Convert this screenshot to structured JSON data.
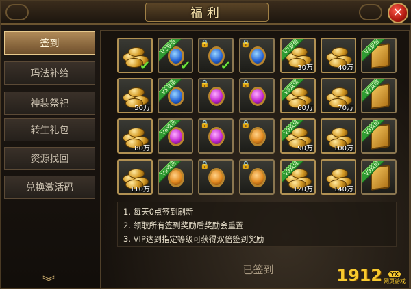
{
  "window": {
    "title": "福利",
    "close_icon": "close-x-icon"
  },
  "sidebar": {
    "items": [
      {
        "label": "签到",
        "active": true
      },
      {
        "label": "玛法补给",
        "active": false
      },
      {
        "label": "神装祭祀",
        "active": false
      },
      {
        "label": "转生礼包",
        "active": false
      },
      {
        "label": "资源找回",
        "active": false
      },
      {
        "label": "兑换激活码",
        "active": false
      }
    ],
    "more_icon": "chevron-down-icon"
  },
  "rewards": [
    {
      "icon": "coins-icon",
      "vip": "",
      "amount": "",
      "signed": true,
      "locked": false
    },
    {
      "icon": "blue-gem-icon",
      "vip": "V2双倍",
      "amount": "",
      "signed": true,
      "locked": false
    },
    {
      "icon": "blue-gem-icon",
      "vip": "",
      "amount": "",
      "signed": true,
      "locked": true
    },
    {
      "icon": "blue-gem-icon",
      "vip": "",
      "amount": "",
      "signed": false,
      "locked": true
    },
    {
      "icon": "coins-icon",
      "vip": "V3双倍",
      "amount": "30万",
      "signed": false,
      "locked": false
    },
    {
      "icon": "coins-icon",
      "vip": "",
      "amount": "40万",
      "signed": false,
      "locked": false
    },
    {
      "icon": "scroll-icon",
      "vip": "V4双倍",
      "amount": "",
      "signed": false,
      "locked": false
    },
    {
      "icon": "coins-icon",
      "vip": "",
      "amount": "50万",
      "signed": false,
      "locked": false
    },
    {
      "icon": "blue-gem-icon",
      "vip": "V5双倍",
      "amount": "",
      "signed": false,
      "locked": false
    },
    {
      "icon": "purple-gem-icon",
      "vip": "",
      "amount": "",
      "signed": false,
      "locked": true
    },
    {
      "icon": "purple-gem-icon",
      "vip": "",
      "amount": "",
      "signed": false,
      "locked": true
    },
    {
      "icon": "coins-icon",
      "vip": "V6双倍",
      "amount": "60万",
      "signed": false,
      "locked": false
    },
    {
      "icon": "coins-icon",
      "vip": "",
      "amount": "70万",
      "signed": false,
      "locked": false
    },
    {
      "icon": "scroll-icon",
      "vip": "V7双倍",
      "amount": "",
      "signed": false,
      "locked": false
    },
    {
      "icon": "coins-icon",
      "vip": "",
      "amount": "80万",
      "signed": false,
      "locked": false
    },
    {
      "icon": "purple-gem-icon",
      "vip": "V8双倍",
      "amount": "",
      "signed": false,
      "locked": false
    },
    {
      "icon": "purple-gem-icon",
      "vip": "",
      "amount": "",
      "signed": false,
      "locked": true
    },
    {
      "icon": "orange-gem-icon",
      "vip": "",
      "amount": "",
      "signed": false,
      "locked": true
    },
    {
      "icon": "coins-icon",
      "vip": "V9双倍",
      "amount": "90万",
      "signed": false,
      "locked": false
    },
    {
      "icon": "coins-icon",
      "vip": "",
      "amount": "100万",
      "signed": false,
      "locked": false
    },
    {
      "icon": "scroll-icon",
      "vip": "V8双倍",
      "amount": "",
      "signed": false,
      "locked": false
    },
    {
      "icon": "coins-icon",
      "vip": "",
      "amount": "110万",
      "signed": false,
      "locked": false
    },
    {
      "icon": "orange-gem-icon",
      "vip": "V9双倍",
      "amount": "",
      "signed": false,
      "locked": false
    },
    {
      "icon": "orange-gem-icon",
      "vip": "",
      "amount": "",
      "signed": false,
      "locked": true
    },
    {
      "icon": "orange-gem-icon",
      "vip": "",
      "amount": "",
      "signed": false,
      "locked": true
    },
    {
      "icon": "coins-icon",
      "vip": "V9双倍",
      "amount": "120万",
      "signed": false,
      "locked": false
    },
    {
      "icon": "coins-icon",
      "vip": "",
      "amount": "140万",
      "signed": false,
      "locked": false
    },
    {
      "icon": "scroll-icon",
      "vip": "V9双倍",
      "amount": "",
      "signed": false,
      "locked": false
    }
  ],
  "notes": [
    "1. 每天0点签到刷新",
    "2. 领取所有签到奖励后奖励会重置",
    "3. VIP达到指定等级可获得双倍签到奖励"
  ],
  "sign_button": "已签到",
  "watermark": {
    "number": "1912",
    "badge": "YX",
    "text": "网页游戏"
  },
  "colors": {
    "accent_gold": "#c9a25a",
    "vip_ribbon": "#2f9a32",
    "close_red": "#b01a10"
  }
}
